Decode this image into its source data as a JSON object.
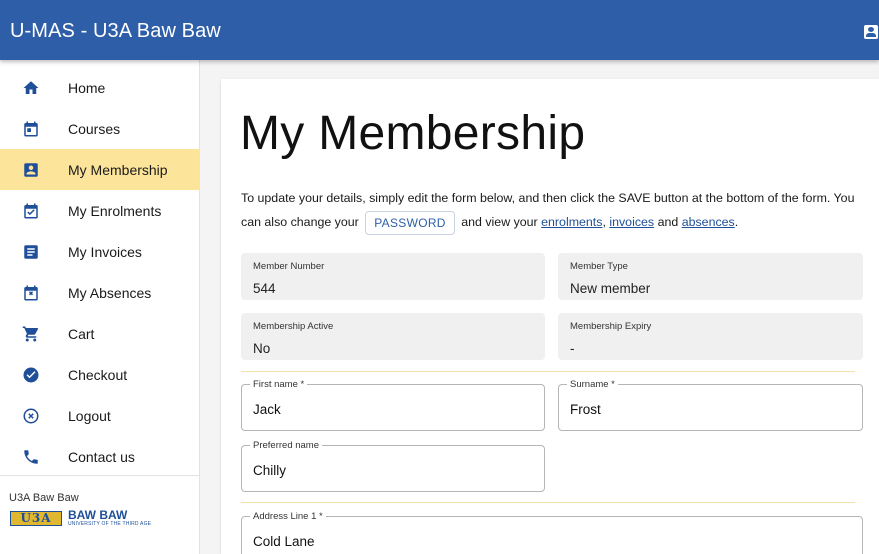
{
  "app": {
    "title": "U-MAS - U3A Baw Baw",
    "account_icon": "account-box-icon"
  },
  "sidebar": {
    "items": [
      {
        "label": "Home",
        "icon": "home-icon"
      },
      {
        "label": "Courses",
        "icon": "calendar-icon"
      },
      {
        "label": "My Membership",
        "icon": "account-box-icon",
        "active": true
      },
      {
        "label": "My Enrolments",
        "icon": "calendar-check-icon"
      },
      {
        "label": "My Invoices",
        "icon": "list-box-icon"
      },
      {
        "label": "My Absences",
        "icon": "calendar-x-icon"
      },
      {
        "label": "Cart",
        "icon": "cart-icon"
      },
      {
        "label": "Checkout",
        "icon": "check-circle-icon"
      },
      {
        "label": "Logout",
        "icon": "x-circle-icon"
      },
      {
        "label": "Contact us",
        "icon": "phone-icon"
      }
    ],
    "org_name": "U3A Baw Baw",
    "logo": {
      "mark": "U3A",
      "name": "BAW BAW",
      "tagline": "UNIVERSITY OF THE THIRD AGE"
    }
  },
  "main": {
    "title": "My Membership",
    "intro": {
      "part1": "To update your details, simply edit the form below, and then click the SAVE button at the bottom of the form. You can also change your",
      "password_button": "PASSWORD",
      "part2": "and view your",
      "link_enrolments": "enrolments",
      "comma": ",",
      "link_invoices": "invoices",
      "and": "and",
      "link_absences": "absences",
      "period": "."
    },
    "fields": {
      "member_number": {
        "label": "Member Number",
        "value": "544"
      },
      "member_type": {
        "label": "Member Type",
        "value": "New member"
      },
      "membership_active": {
        "label": "Membership Active",
        "value": "No"
      },
      "membership_expiry": {
        "label": "Membership Expiry",
        "value": "-"
      },
      "first_name": {
        "label": "First name *",
        "value": "Jack"
      },
      "surname": {
        "label": "Surname *",
        "value": "Frost"
      },
      "preferred_name": {
        "label": "Preferred name",
        "value": "Chilly"
      },
      "address_line_1": {
        "label": "Address Line 1 *",
        "value": "Cold Lane"
      }
    }
  },
  "colors": {
    "appbar": "#2e5ea8",
    "active_nav": "#fce49a",
    "link": "#1f4f99"
  }
}
